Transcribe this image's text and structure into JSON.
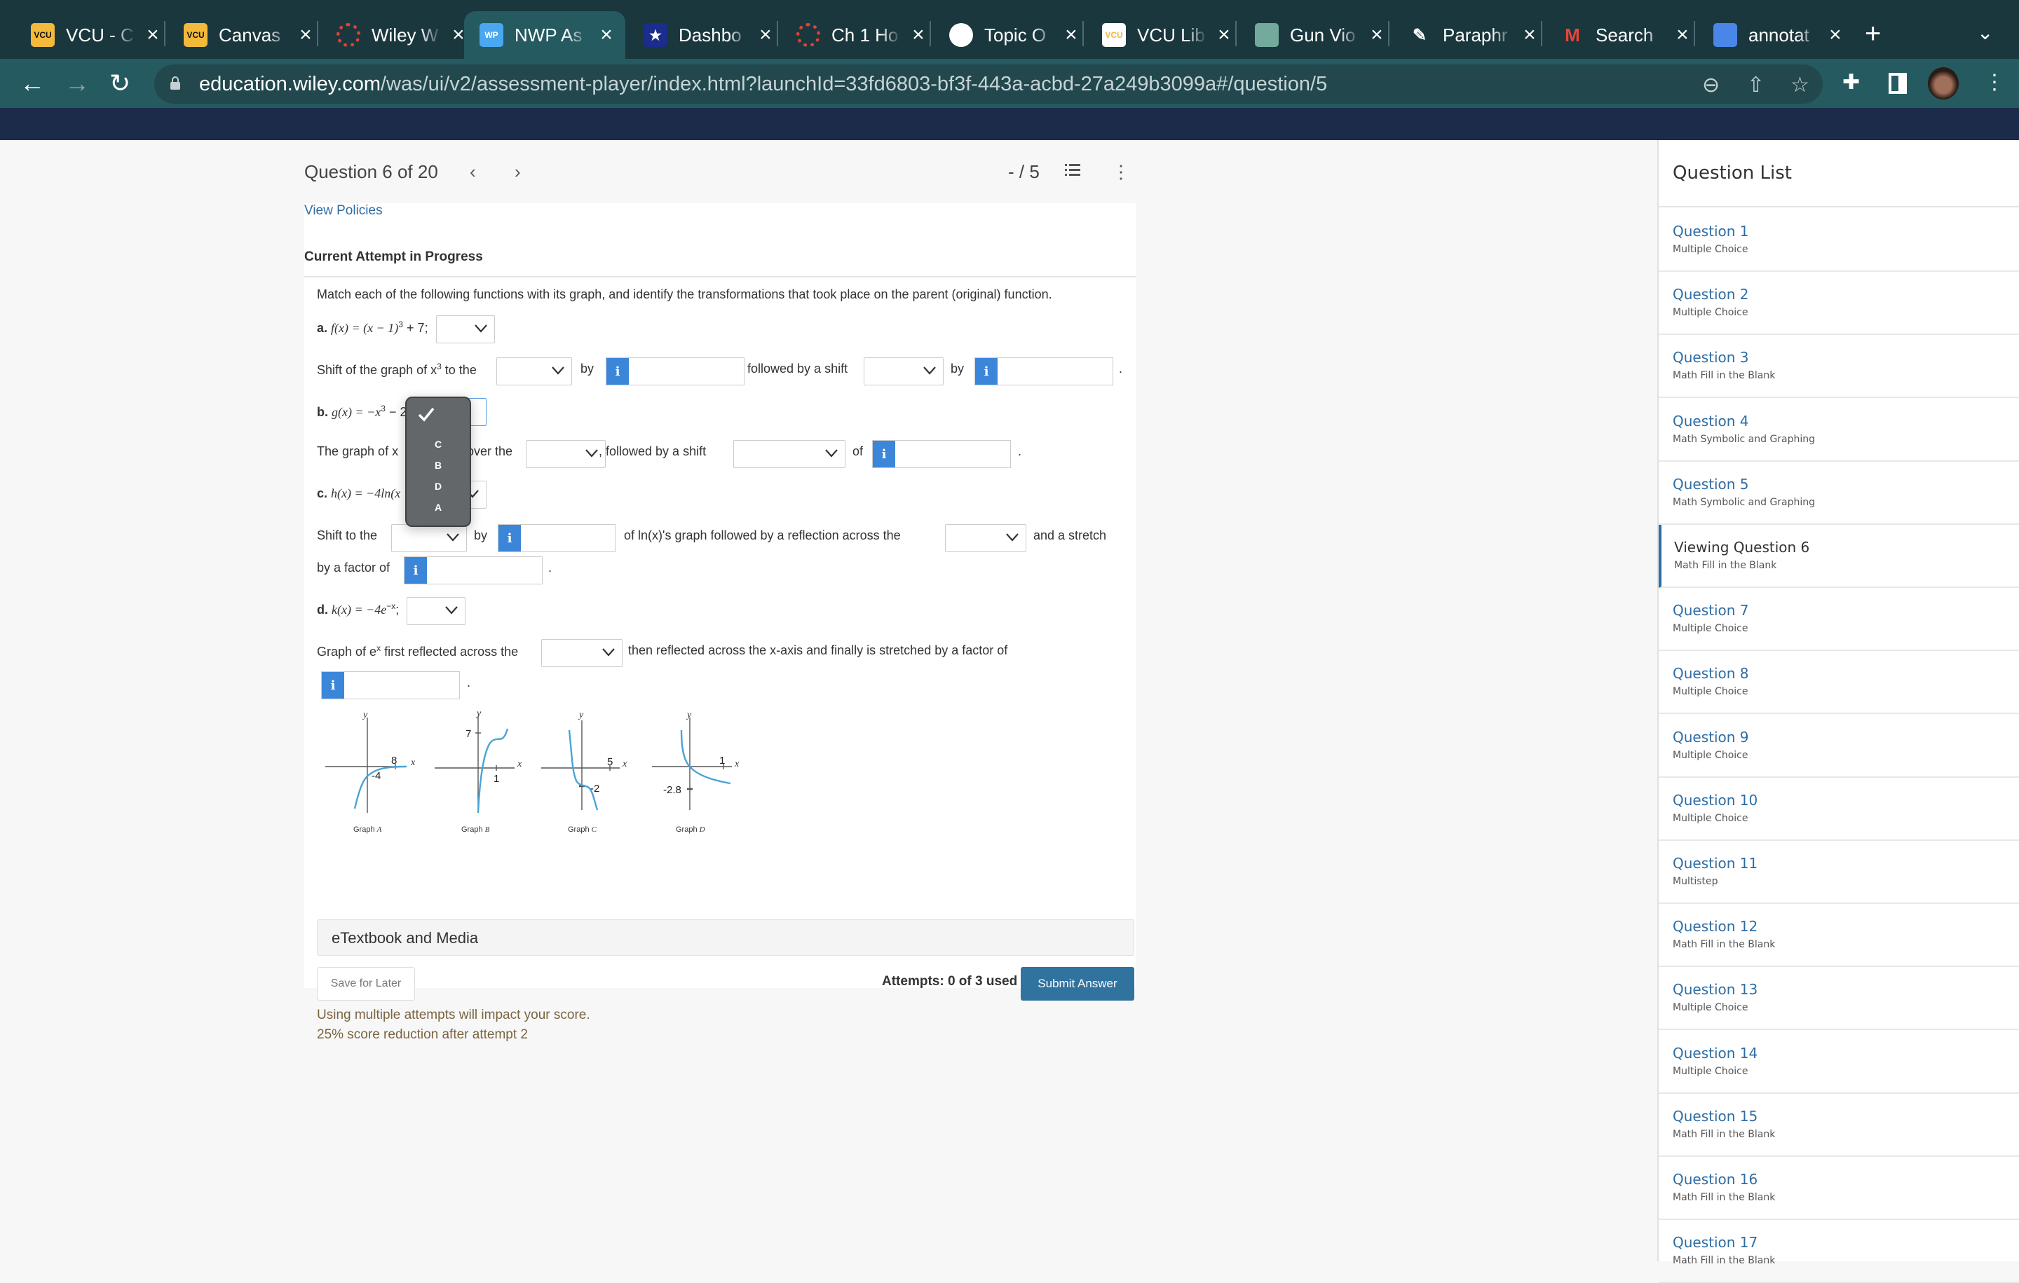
{
  "browser": {
    "tabs": [
      {
        "title": "VCU - C",
        "favicon": "vcu-icon",
        "fav_color": "#f2b93b",
        "fav_text": "VCU",
        "active": false
      },
      {
        "title": "Canvas",
        "favicon": "vcu-icon",
        "fav_color": "#f2b93b",
        "fav_text": "VCU",
        "active": false
      },
      {
        "title": "Wiley W",
        "favicon": "canvas-icon",
        "fav_color": "#e2432e",
        "fav_text": "",
        "active": false
      },
      {
        "title": "NWP As",
        "favicon": "wileyplus-icon",
        "fav_color": "#4aa8f0",
        "fav_text": "WP",
        "active": true
      },
      {
        "title": "Dashbo",
        "favicon": "star-shield-icon",
        "fav_color": "#1a2c8c",
        "fav_text": "★",
        "active": false
      },
      {
        "title": "Ch 1 Ho",
        "favicon": "canvas-icon",
        "fav_color": "#e2432e",
        "fav_text": "",
        "active": false
      },
      {
        "title": "Topic O",
        "favicon": "globe-icon",
        "fav_color": "#ffffff",
        "fav_text": "",
        "active": false
      },
      {
        "title": "VCU Lib",
        "favicon": "vcu-icon",
        "fav_color": "#ffffff",
        "fav_text": "VCU",
        "active": false
      },
      {
        "title": "Gun Vio",
        "favicon": "chatgpt-icon",
        "fav_color": "#74aa9c",
        "fav_text": "",
        "active": false
      },
      {
        "title": "Paraphr",
        "favicon": "feather-icon",
        "fav_color": "transparent",
        "fav_text": "",
        "active": false
      },
      {
        "title": "Search",
        "favicon": "gmail-icon",
        "fav_color": "transparent",
        "fav_text": "M",
        "active": false
      },
      {
        "title": "annotat",
        "favicon": "docs-icon",
        "fav_color": "#4a86e8",
        "fav_text": "",
        "active": false
      }
    ],
    "url_host": "education.wiley.com",
    "url_path": "/was/ui/v2/assessment-player/index.html?launchId=33fd6803-bf3f-443a-acbd-27a249b3099a#/question/5"
  },
  "question_header": {
    "title": "Question 6 of 20",
    "score": "- / 5"
  },
  "card": {
    "view_policies": "View Policies",
    "attempt_status": "Current Attempt in Progress",
    "prompt": "Match each of the following functions with its graph, and identify the transformations that took place on the parent (original) function.",
    "parts": {
      "a_label": "a.",
      "a_func": "f(x) = (x − 1)",
      "a_exp": "3",
      "a_tail": " + 7;",
      "a_s1": "Shift of the graph of x",
      "a_s1_exp": "3",
      "a_s2": " to the",
      "a_by1": "by",
      "a_follow": "followed by a shift",
      "a_by2": "by",
      "b_label": "b.",
      "b_func": "g(x) = −x",
      "b_exp": "3",
      "b_tail": " − 2",
      "b_s1": "The graph of x",
      "b_over": "over the",
      "b_follow": ", followed by a shift",
      "b_of": "of",
      "c_label": "c.",
      "c_func": "h(x) = −4ln(x",
      "c_s1": "Shift to the",
      "c_by": "by",
      "c_mid": "of ln(x)'s graph followed by a reflection across the",
      "c_stretch": "and a stretch",
      "c_factor": "by a factor of",
      "d_label": "d.",
      "d_func": "k(x) = −4e",
      "d_exp": "−x",
      "d_tail": ";",
      "d_s1": "Graph of e",
      "d_s1_exp": "x",
      "d_s2": " first reflected across the",
      "d_then": "then reflected across the x-axis and finally is stretched by a factor of",
      "period": "."
    },
    "info_label": "i",
    "dropdown_open": {
      "selected_blank": true,
      "options": [
        "C",
        "B",
        "D",
        "A"
      ]
    },
    "graphs": [
      {
        "caption_prefix": "Graph ",
        "caption_letter": "A",
        "labels": [
          "y",
          "x",
          "8",
          "-4"
        ]
      },
      {
        "caption_prefix": "Graph ",
        "caption_letter": "B",
        "labels": [
          "y",
          "x",
          "7",
          "1"
        ]
      },
      {
        "caption_prefix": "Graph ",
        "caption_letter": "C",
        "labels": [
          "y",
          "x",
          "5",
          "-2"
        ]
      },
      {
        "caption_prefix": "Graph ",
        "caption_letter": "D",
        "labels": [
          "y",
          "x",
          "1",
          "-2.8"
        ]
      }
    ],
    "etextbook": "eTextbook and Media",
    "save_later": "Save for Later",
    "attempts": "Attempts: 0 of 3 used",
    "submit": "Submit Answer",
    "warning1": "Using multiple attempts will impact your score.",
    "warning2": "25% score reduction after attempt 2"
  },
  "question_list": {
    "title": "Question List",
    "items": [
      {
        "name": "Question 1",
        "type": "Multiple Choice"
      },
      {
        "name": "Question 2",
        "type": "Multiple Choice"
      },
      {
        "name": "Question 3",
        "type": "Math Fill in the Blank"
      },
      {
        "name": "Question 4",
        "type": "Math Symbolic and Graphing"
      },
      {
        "name": "Question 5",
        "type": "Math Symbolic and Graphing"
      },
      {
        "name": "Viewing Question 6",
        "type": "Math Fill in the Blank",
        "current": true
      },
      {
        "name": "Question 7",
        "type": "Multiple Choice"
      },
      {
        "name": "Question 8",
        "type": "Multiple Choice"
      },
      {
        "name": "Question 9",
        "type": "Multiple Choice"
      },
      {
        "name": "Question 10",
        "type": "Multiple Choice"
      },
      {
        "name": "Question 11",
        "type": "Multistep"
      },
      {
        "name": "Question 12",
        "type": "Math Fill in the Blank"
      },
      {
        "name": "Question 13",
        "type": "Multiple Choice"
      },
      {
        "name": "Question 14",
        "type": "Multiple Choice"
      },
      {
        "name": "Question 15",
        "type": "Math Fill in the Blank"
      },
      {
        "name": "Question 16",
        "type": "Math Fill in the Blank"
      },
      {
        "name": "Question 17",
        "type": "Math Fill in the Blank"
      }
    ]
  },
  "colors": {
    "accent": "#2e6da4",
    "info_blue": "#3c86d9",
    "submit": "#31739f",
    "curve": "#4aa3d6",
    "warning": "#7a6440"
  }
}
